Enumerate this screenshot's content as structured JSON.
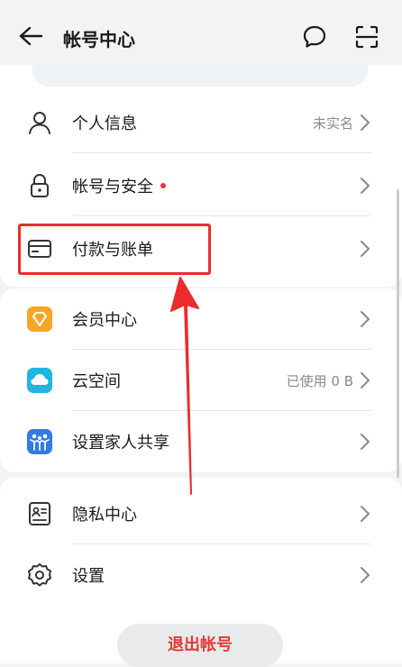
{
  "header": {
    "title": "帐号中心"
  },
  "icons": {
    "back": "arrow-left-icon",
    "message": "chat-bubble-icon",
    "scan": "scan-icon"
  },
  "sections": [
    {
      "items": [
        {
          "label": "个人信息",
          "value": "未实名",
          "icon": "person-icon"
        },
        {
          "label": "帐号与安全",
          "value": "",
          "icon": "lock-icon",
          "badge": "red-dot"
        },
        {
          "label": "付款与账单",
          "value": "",
          "icon": "card-icon",
          "highlighted": true
        }
      ]
    },
    {
      "items": [
        {
          "label": "会员中心",
          "value": "",
          "icon": "diamond-icon"
        },
        {
          "label": "云空间",
          "value": "已使用 0 B",
          "icon": "cloud-icon"
        },
        {
          "label": "设置家人共享",
          "value": "",
          "icon": "family-icon"
        }
      ]
    },
    {
      "items": [
        {
          "label": "隐私中心",
          "value": "",
          "icon": "privacy-card-icon"
        },
        {
          "label": "设置",
          "value": "",
          "icon": "gear-icon"
        }
      ]
    }
  ],
  "logout_label": "退出帐号",
  "colors": {
    "accent_red": "#e03a3a",
    "annotation_red": "#ee2b2b",
    "background": "#f1f3f5"
  }
}
